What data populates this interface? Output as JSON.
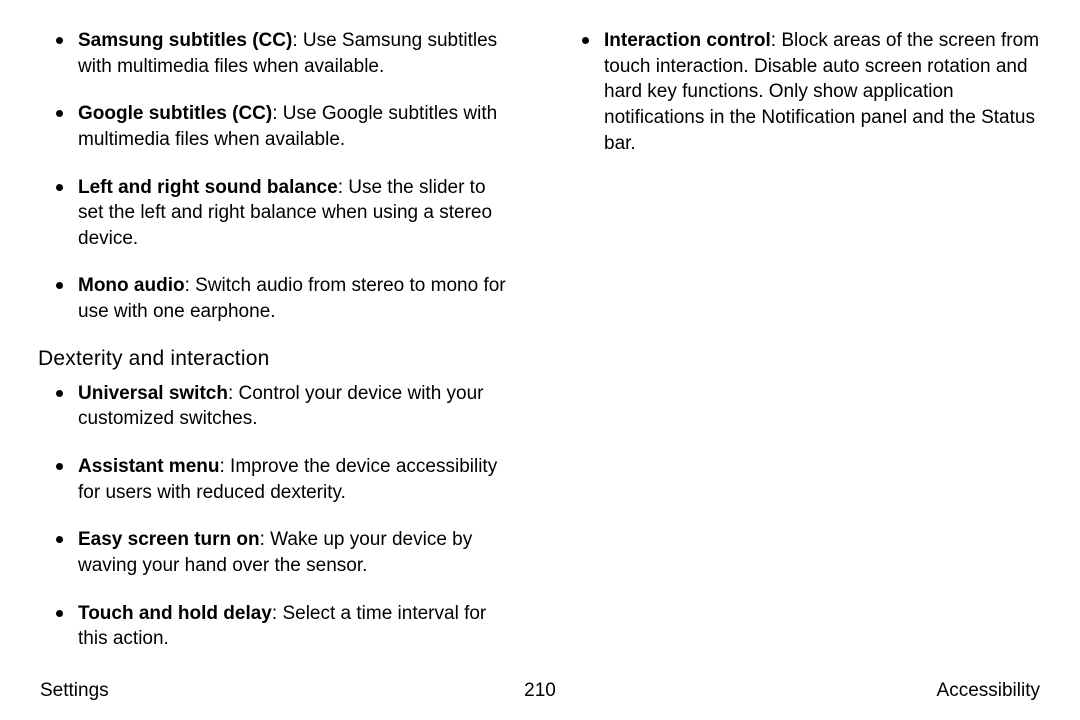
{
  "leftColumn": {
    "topItems": [
      {
        "term": "Samsung subtitles (CC)",
        "desc": ": Use Samsung subtitles with multimedia files when available."
      },
      {
        "term": "Google subtitles (CC)",
        "desc": ": Use Google subtitles with multimedia files when available."
      },
      {
        "term": "Left and right sound balance",
        "desc": ": Use the slider to set the left and right balance when using a stereo device."
      },
      {
        "term": "Mono audio",
        "desc": ": Switch audio from stereo to mono for use with one earphone."
      }
    ],
    "subheading": "Dexterity and interaction",
    "subItems": [
      {
        "term": "Universal switch",
        "desc": ": Control your device with your customized switches."
      },
      {
        "term": "Assistant menu",
        "desc": ": Improve the device accessibility for users with reduced dexterity."
      },
      {
        "term": "Easy screen turn on",
        "desc": ": Wake up your device by waving your hand over the sensor."
      },
      {
        "term": "Touch and hold delay",
        "desc": ": Select a time interval for this action."
      }
    ]
  },
  "rightColumn": {
    "items": [
      {
        "term": "Interaction control",
        "desc": ": Block areas of the screen from touch interaction. Disable auto screen rotation and hard key functions. Only show application notifications in the Notification panel and the Status bar."
      }
    ]
  },
  "footer": {
    "left": "Settings",
    "center": "210",
    "right": "Accessibility"
  }
}
